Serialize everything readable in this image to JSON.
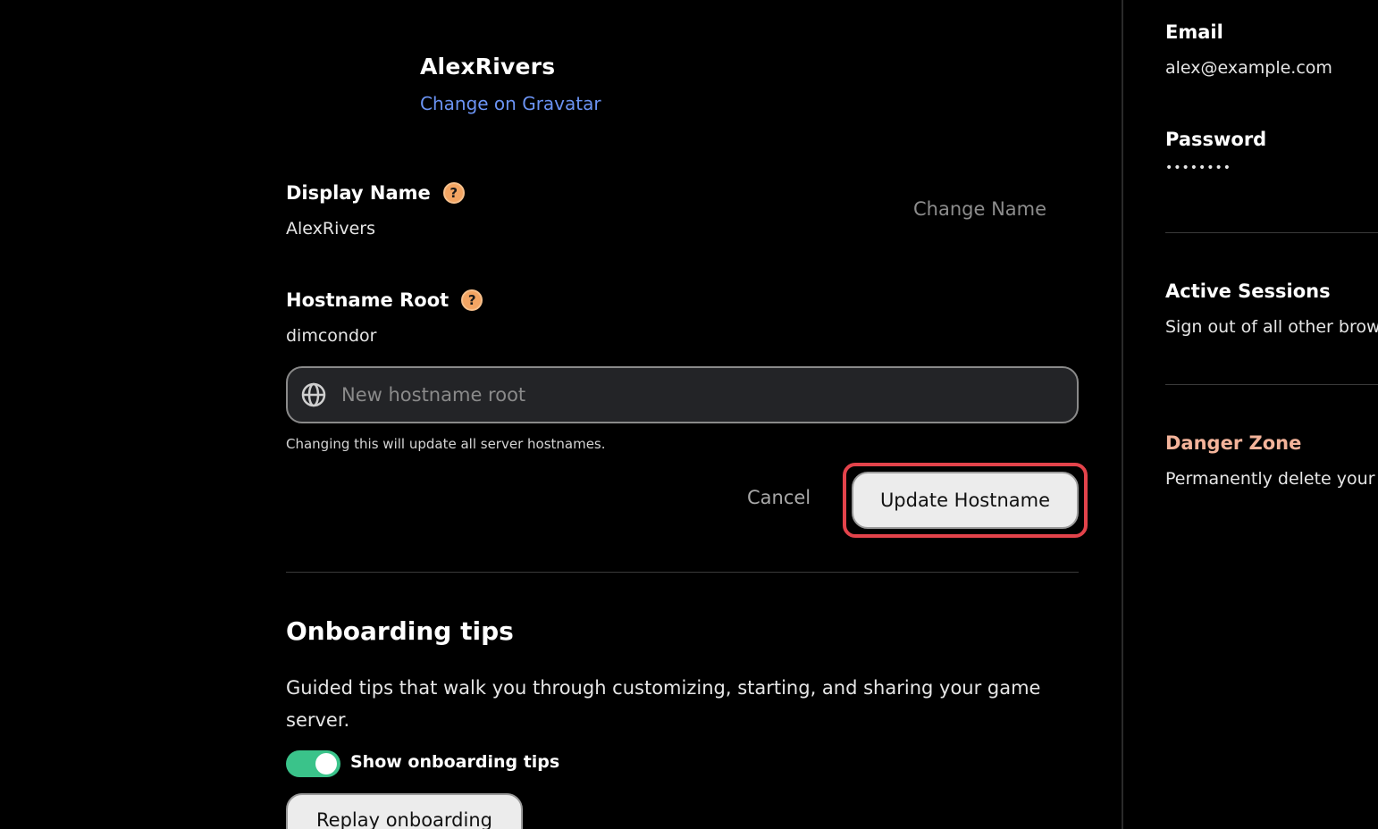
{
  "profile": {
    "username": "AlexRivers",
    "gravatar_link": "Change on Gravatar"
  },
  "display_name": {
    "label": "Display Name",
    "value": "AlexRivers",
    "change_label": "Change Name",
    "help_icon": "question-circle-icon"
  },
  "hostname": {
    "label": "Hostname Root",
    "value": "dimcondor",
    "input_value": "",
    "input_placeholder": "New hostname root",
    "input_icon": "globe-icon",
    "hint": "Changing this will update all server hostnames.",
    "cancel_label": "Cancel",
    "update_label": "Update Hostname",
    "help_icon": "question-circle-icon"
  },
  "onboarding": {
    "title": "Onboarding tips",
    "description": "Guided tips that walk you through customizing, starting, and sharing your game server.",
    "toggle_label": "Show onboarding tips",
    "toggle_on": true,
    "replay_label": "Replay onboarding"
  },
  "account": {
    "email_label": "Email",
    "email_value": "alex@example.com",
    "password_label": "Password",
    "password_value": "••••••••",
    "sessions_label": "Active Sessions",
    "sessions_desc": "Sign out of all other brow",
    "danger_label": "Danger Zone",
    "danger_desc": "Permanently delete your"
  },
  "colors": {
    "link": "#6b93f3",
    "help_icon": "#f3a563",
    "toggle_on": "#3ac38a",
    "highlight": "#e3434b",
    "danger": "#f3b39a"
  }
}
